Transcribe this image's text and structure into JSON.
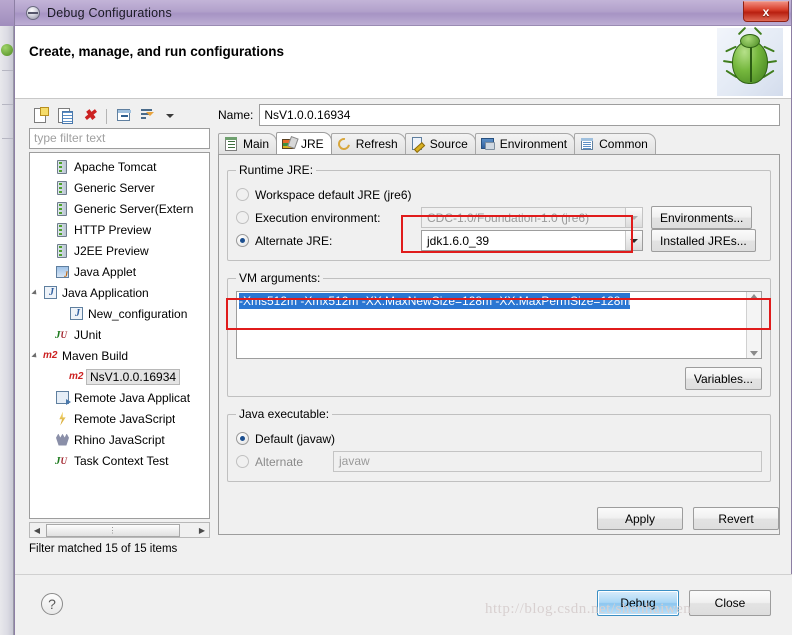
{
  "window": {
    "title": "Debug Configurations",
    "app_icon": "eclipse-debug-icon",
    "close_label": "x"
  },
  "header": {
    "title": "Create, manage, and run configurations",
    "banner_icon": "green-beetle-icon"
  },
  "tree_toolbar": {
    "buttons": [
      {
        "name": "new-launch-configuration",
        "icon": "new-document-icon"
      },
      {
        "name": "duplicate-launch-configuration",
        "icon": "duplicate-icon"
      },
      {
        "name": "delete-launch-configuration",
        "icon": "delete-red-x-icon"
      },
      {
        "name": "collapse-all",
        "icon": "collapse-all-icon"
      },
      {
        "name": "filter-launch-configurations",
        "icon": "filter-icon"
      },
      {
        "name": "view-menu",
        "icon": "chevron-down-icon"
      }
    ]
  },
  "filter": {
    "placeholder": "type filter text",
    "value": "",
    "status": "Filter matched 15 of 15 items"
  },
  "tree": {
    "items": [
      {
        "label": "Apache Tomcat",
        "icon": "server-icon",
        "indent": 1,
        "twisty": "none",
        "selected": false
      },
      {
        "label": "Generic Server",
        "icon": "server-icon",
        "indent": 1,
        "twisty": "none",
        "selected": false
      },
      {
        "label": "Generic Server(Extern",
        "icon": "server-icon",
        "indent": 1,
        "twisty": "none",
        "selected": false
      },
      {
        "label": "HTTP Preview",
        "icon": "server-icon",
        "indent": 1,
        "twisty": "none",
        "selected": false
      },
      {
        "label": "J2EE Preview",
        "icon": "server-icon",
        "indent": 1,
        "twisty": "none",
        "selected": false
      },
      {
        "label": "Java Applet",
        "icon": "java-applet-icon",
        "indent": 1,
        "twisty": "none",
        "selected": false
      },
      {
        "label": "Java Application",
        "icon": "java-application-icon",
        "indent": 0,
        "twisty": "open",
        "selected": false
      },
      {
        "label": "New_configuration",
        "icon": "java-application-icon",
        "indent": 2,
        "twisty": "none",
        "selected": false
      },
      {
        "label": "JUnit",
        "icon": "junit-icon",
        "indent": 1,
        "twisty": "none",
        "selected": false
      },
      {
        "label": "Maven Build",
        "icon": "maven-m2-icon",
        "indent": 0,
        "twisty": "open",
        "selected": false
      },
      {
        "label": "NsV1.0.0.16934",
        "icon": "maven-m2-icon",
        "indent": 2,
        "twisty": "none",
        "selected": true
      },
      {
        "label": "Remote Java Applicat",
        "icon": "remote-java-app-icon",
        "indent": 1,
        "twisty": "none",
        "selected": false
      },
      {
        "label": "Remote JavaScript",
        "icon": "remote-javascript-icon",
        "indent": 1,
        "twisty": "none",
        "selected": false
      },
      {
        "label": "Rhino JavaScript",
        "icon": "rhino-javascript-icon",
        "indent": 1,
        "twisty": "none",
        "selected": false
      },
      {
        "label": "Task Context Test",
        "icon": "junit-icon",
        "indent": 1,
        "twisty": "none",
        "selected": false
      }
    ]
  },
  "name_row": {
    "label": "Name:",
    "value": "NsV1.0.0.16934"
  },
  "tabs": [
    {
      "label": "Main",
      "icon": "main-tab-icon",
      "active": false
    },
    {
      "label": "JRE",
      "icon": "jre-tab-icon",
      "active": true
    },
    {
      "label": "Refresh",
      "icon": "refresh-tab-icon",
      "active": false
    },
    {
      "label": "Source",
      "icon": "source-tab-icon",
      "active": false
    },
    {
      "label": "Environment",
      "icon": "environment-tab-icon",
      "active": false
    },
    {
      "label": "Common",
      "icon": "common-tab-icon",
      "active": false
    }
  ],
  "runtime_jre": {
    "legend": "Runtime JRE:",
    "workspace_default": {
      "label": "Workspace default JRE (jre6)",
      "selected": false
    },
    "execution_environment": {
      "label": "Execution environment:",
      "selected": false,
      "value": "CDC-1.0/Foundation-1.0 (jre6)",
      "disabled": true,
      "button": "Environments..."
    },
    "alternate_jre": {
      "label": "Alternate JRE:",
      "selected": true,
      "value": "jdk1.6.0_39",
      "button": "Installed JREs...",
      "highlighted": true
    }
  },
  "vm_arguments": {
    "legend": "VM arguments:",
    "value": "-Xms512m -Xmx512m -XX:MaxNewSize=128m -XX:MaxPermSize=128m",
    "selected": true,
    "highlighted": true,
    "variables_button": "Variables..."
  },
  "java_executable": {
    "legend": "Java executable:",
    "default": {
      "label": "Default (javaw)",
      "selected": true
    },
    "alternate": {
      "label": "Alternate",
      "selected": false,
      "value": "javaw",
      "disabled": true
    }
  },
  "action_buttons": {
    "apply": "Apply",
    "revert": "Revert"
  },
  "footer": {
    "help_icon": "help-question-icon",
    "debug": "Debug",
    "close": "Close"
  },
  "watermark": "http://blog.csdn.net/shenhaiwen",
  "colors": {
    "titlebar": "#b2a1cb",
    "highlight_red": "#e01b1b",
    "selection_blue": "#2a76d2",
    "primary_button": "#8cc6ef"
  }
}
